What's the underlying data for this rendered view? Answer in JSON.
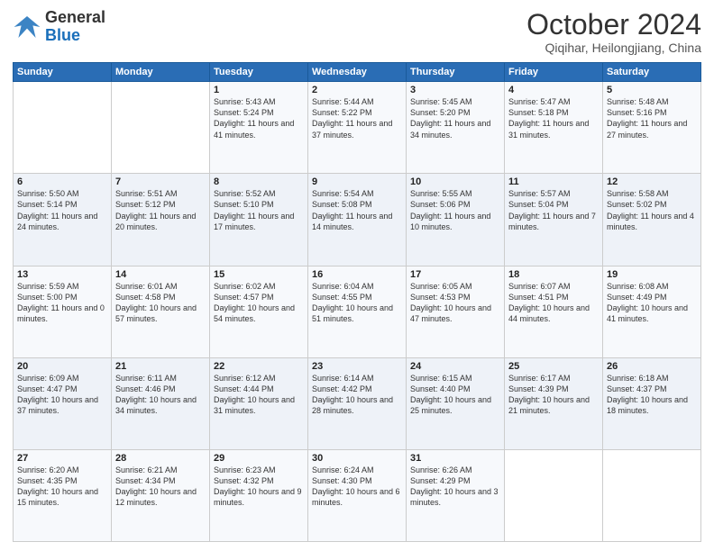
{
  "logo": {
    "line1": "General",
    "line2": "Blue"
  },
  "header": {
    "month": "October 2024",
    "location": "Qiqihar, Heilongjiang, China"
  },
  "weekdays": [
    "Sunday",
    "Monday",
    "Tuesday",
    "Wednesday",
    "Thursday",
    "Friday",
    "Saturday"
  ],
  "weeks": [
    [
      {
        "day": "",
        "text": ""
      },
      {
        "day": "",
        "text": ""
      },
      {
        "day": "1",
        "text": "Sunrise: 5:43 AM\nSunset: 5:24 PM\nDaylight: 11 hours and 41 minutes."
      },
      {
        "day": "2",
        "text": "Sunrise: 5:44 AM\nSunset: 5:22 PM\nDaylight: 11 hours and 37 minutes."
      },
      {
        "day": "3",
        "text": "Sunrise: 5:45 AM\nSunset: 5:20 PM\nDaylight: 11 hours and 34 minutes."
      },
      {
        "day": "4",
        "text": "Sunrise: 5:47 AM\nSunset: 5:18 PM\nDaylight: 11 hours and 31 minutes."
      },
      {
        "day": "5",
        "text": "Sunrise: 5:48 AM\nSunset: 5:16 PM\nDaylight: 11 hours and 27 minutes."
      }
    ],
    [
      {
        "day": "6",
        "text": "Sunrise: 5:50 AM\nSunset: 5:14 PM\nDaylight: 11 hours and 24 minutes."
      },
      {
        "day": "7",
        "text": "Sunrise: 5:51 AM\nSunset: 5:12 PM\nDaylight: 11 hours and 20 minutes."
      },
      {
        "day": "8",
        "text": "Sunrise: 5:52 AM\nSunset: 5:10 PM\nDaylight: 11 hours and 17 minutes."
      },
      {
        "day": "9",
        "text": "Sunrise: 5:54 AM\nSunset: 5:08 PM\nDaylight: 11 hours and 14 minutes."
      },
      {
        "day": "10",
        "text": "Sunrise: 5:55 AM\nSunset: 5:06 PM\nDaylight: 11 hours and 10 minutes."
      },
      {
        "day": "11",
        "text": "Sunrise: 5:57 AM\nSunset: 5:04 PM\nDaylight: 11 hours and 7 minutes."
      },
      {
        "day": "12",
        "text": "Sunrise: 5:58 AM\nSunset: 5:02 PM\nDaylight: 11 hours and 4 minutes."
      }
    ],
    [
      {
        "day": "13",
        "text": "Sunrise: 5:59 AM\nSunset: 5:00 PM\nDaylight: 11 hours and 0 minutes."
      },
      {
        "day": "14",
        "text": "Sunrise: 6:01 AM\nSunset: 4:58 PM\nDaylight: 10 hours and 57 minutes."
      },
      {
        "day": "15",
        "text": "Sunrise: 6:02 AM\nSunset: 4:57 PM\nDaylight: 10 hours and 54 minutes."
      },
      {
        "day": "16",
        "text": "Sunrise: 6:04 AM\nSunset: 4:55 PM\nDaylight: 10 hours and 51 minutes."
      },
      {
        "day": "17",
        "text": "Sunrise: 6:05 AM\nSunset: 4:53 PM\nDaylight: 10 hours and 47 minutes."
      },
      {
        "day": "18",
        "text": "Sunrise: 6:07 AM\nSunset: 4:51 PM\nDaylight: 10 hours and 44 minutes."
      },
      {
        "day": "19",
        "text": "Sunrise: 6:08 AM\nSunset: 4:49 PM\nDaylight: 10 hours and 41 minutes."
      }
    ],
    [
      {
        "day": "20",
        "text": "Sunrise: 6:09 AM\nSunset: 4:47 PM\nDaylight: 10 hours and 37 minutes."
      },
      {
        "day": "21",
        "text": "Sunrise: 6:11 AM\nSunset: 4:46 PM\nDaylight: 10 hours and 34 minutes."
      },
      {
        "day": "22",
        "text": "Sunrise: 6:12 AM\nSunset: 4:44 PM\nDaylight: 10 hours and 31 minutes."
      },
      {
        "day": "23",
        "text": "Sunrise: 6:14 AM\nSunset: 4:42 PM\nDaylight: 10 hours and 28 minutes."
      },
      {
        "day": "24",
        "text": "Sunrise: 6:15 AM\nSunset: 4:40 PM\nDaylight: 10 hours and 25 minutes."
      },
      {
        "day": "25",
        "text": "Sunrise: 6:17 AM\nSunset: 4:39 PM\nDaylight: 10 hours and 21 minutes."
      },
      {
        "day": "26",
        "text": "Sunrise: 6:18 AM\nSunset: 4:37 PM\nDaylight: 10 hours and 18 minutes."
      }
    ],
    [
      {
        "day": "27",
        "text": "Sunrise: 6:20 AM\nSunset: 4:35 PM\nDaylight: 10 hours and 15 minutes."
      },
      {
        "day": "28",
        "text": "Sunrise: 6:21 AM\nSunset: 4:34 PM\nDaylight: 10 hours and 12 minutes."
      },
      {
        "day": "29",
        "text": "Sunrise: 6:23 AM\nSunset: 4:32 PM\nDaylight: 10 hours and 9 minutes."
      },
      {
        "day": "30",
        "text": "Sunrise: 6:24 AM\nSunset: 4:30 PM\nDaylight: 10 hours and 6 minutes."
      },
      {
        "day": "31",
        "text": "Sunrise: 6:26 AM\nSunset: 4:29 PM\nDaylight: 10 hours and 3 minutes."
      },
      {
        "day": "",
        "text": ""
      },
      {
        "day": "",
        "text": ""
      }
    ]
  ]
}
